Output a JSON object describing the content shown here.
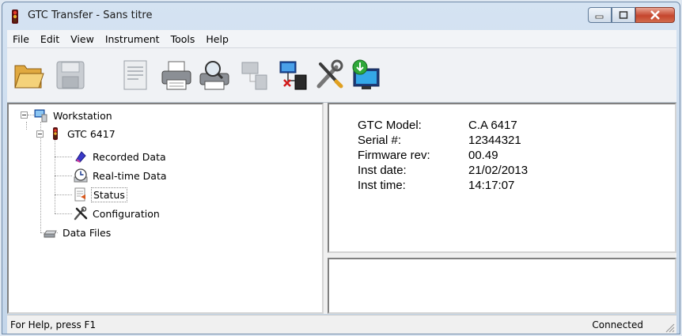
{
  "window": {
    "title": "GTC Transfer - Sans titre"
  },
  "menu": [
    "File",
    "Edit",
    "View",
    "Instrument",
    "Tools",
    "Help"
  ],
  "toolbar": [
    "open-folder-icon",
    "save-icon",
    "report-icon",
    "print-icon",
    "print-preview-icon",
    "network-disconnected-icon",
    "network-disconnect-icon",
    "tools-icon",
    "download-computer-icon"
  ],
  "tree": {
    "workstation": "Workstation",
    "instrument": "GTC 6417",
    "recorded": "Recorded Data",
    "realtime": "Real-time Data",
    "status": "Status",
    "configuration": "Configuration",
    "datafiles": "Data Files"
  },
  "info": [
    {
      "label": "GTC Model:",
      "value": "C.A 6417"
    },
    {
      "label": "Serial #:",
      "value": "12344321"
    },
    {
      "label": "Firmware rev:",
      "value": "00.49"
    },
    {
      "label": "Inst date:",
      "value": "21/02/2013"
    },
    {
      "label": "Inst time:",
      "value": "14:17:07"
    }
  ],
  "statusbar": {
    "help": "For Help, press F1",
    "connection": "Connected"
  }
}
